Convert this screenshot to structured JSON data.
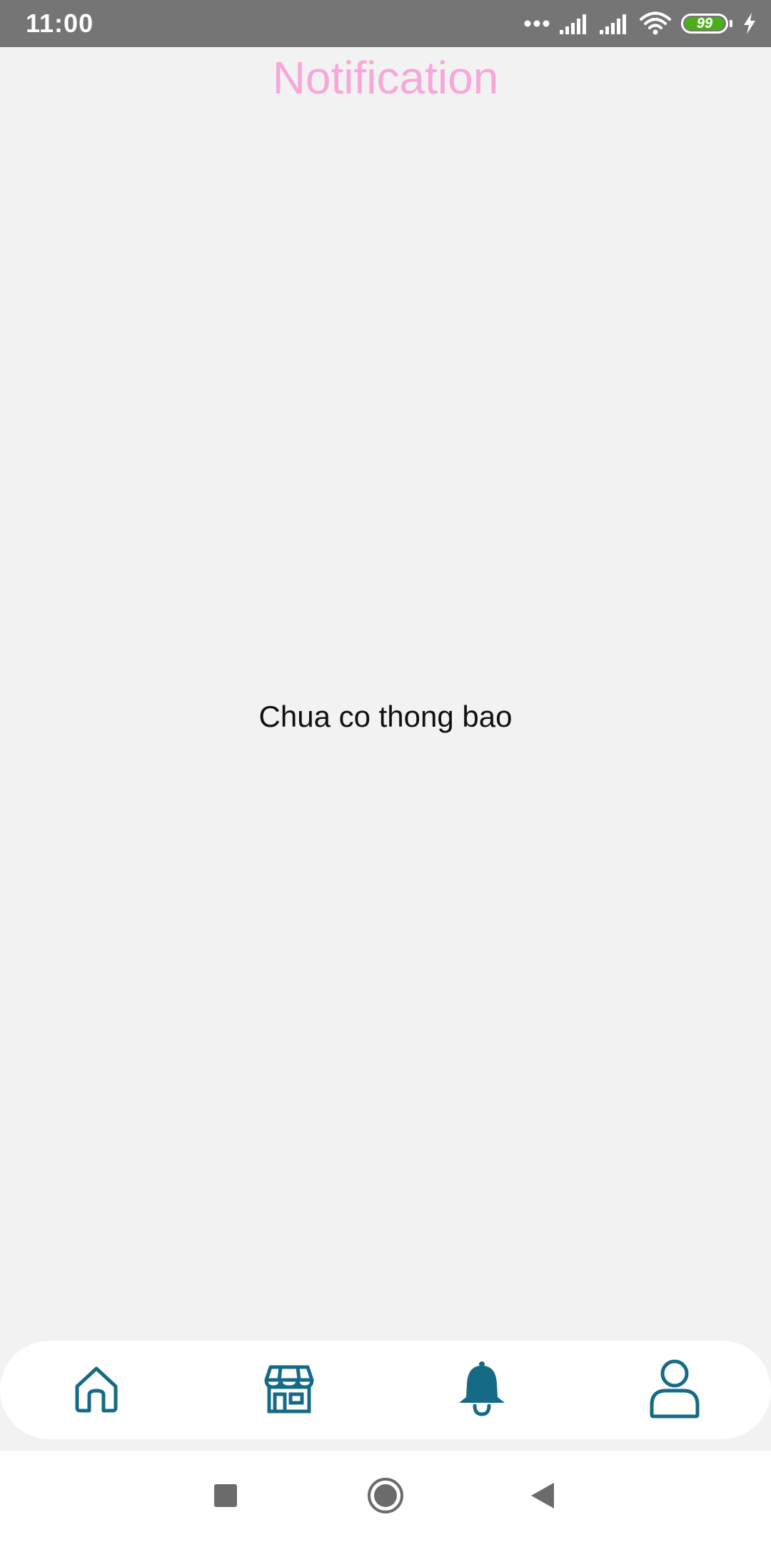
{
  "status_bar": {
    "time": "11:00",
    "battery_level": "99",
    "battery_fraction": 0.99,
    "icons": [
      "more-dots-icon",
      "signal-icon",
      "signal-icon",
      "wifi-icon",
      "battery-icon",
      "charging-icon"
    ]
  },
  "header": {
    "title": "Notification"
  },
  "main": {
    "empty_message": "Chua co thong bao"
  },
  "bottom_nav": {
    "items": [
      "home-icon",
      "store-icon",
      "bell-icon",
      "user-icon"
    ],
    "active": "bell-icon"
  },
  "system_nav": {
    "buttons": [
      "recents-icon",
      "home-circle-icon",
      "back-icon"
    ]
  },
  "colors": {
    "title": "#f7a8d8",
    "nav_icon": "#156b85",
    "status_bar": "#757575",
    "battery_fill": "#4caf1a"
  }
}
